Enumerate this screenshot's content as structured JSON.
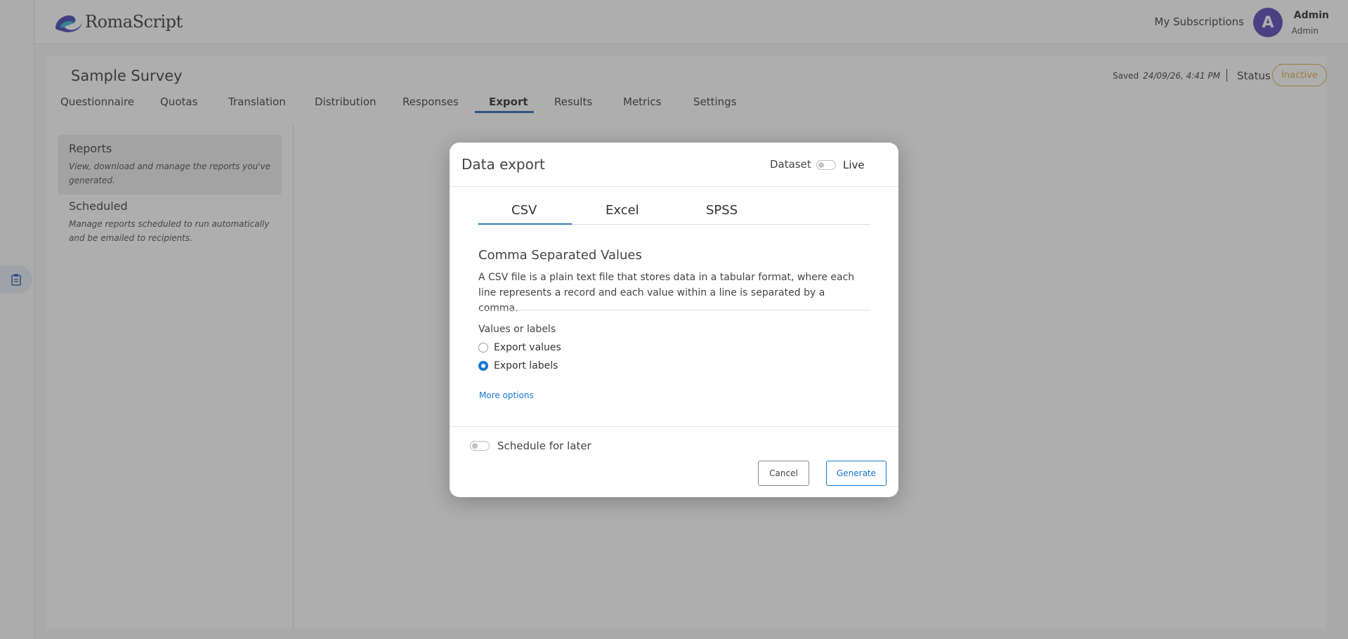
{
  "app": {
    "brand": "RomaScript",
    "subscriptions_label": "My Subscriptions",
    "avatar_initial": "A",
    "user_name": "Admin",
    "user_role": "Admin"
  },
  "survey": {
    "title": "Sample Survey",
    "saved_label": "Saved",
    "saved_time": "24/09/26, 4:41 PM",
    "status_label": "Status",
    "status_value": "Inactive",
    "tabs": [
      "Questionnaire",
      "Quotas",
      "Translation",
      "Distribution",
      "Responses",
      "Export",
      "Results",
      "Metrics",
      "Settings"
    ],
    "active_tab": "Export"
  },
  "sidebar": {
    "items": [
      {
        "title": "Reports",
        "desc": "View, download and manage the reports you've generated."
      },
      {
        "title": "Scheduled",
        "desc": "Manage reports scheduled to run automatically and be emailed to recipients."
      }
    ]
  },
  "modal": {
    "title": "Data export",
    "dataset_label": "Dataset",
    "live_label": "Live",
    "format_tabs": [
      "CSV",
      "Excel",
      "SPSS"
    ],
    "active_format": "CSV",
    "format_title": "Comma Separated Values",
    "format_desc": "A CSV file is a plain text file that stores data in a tabular format, where each line represents a record and each value within a line is separated by a comma.",
    "values_or_labels": "Values or labels",
    "options": [
      {
        "label": "Export values",
        "checked": false
      },
      {
        "label": "Export labels",
        "checked": true
      }
    ],
    "more_options": "More options",
    "schedule_label": "Schedule for later",
    "cancel": "Cancel",
    "generate": "Generate"
  },
  "colors": {
    "accent": "#1677d2",
    "status_inactive": "#e6a23c",
    "avatar": "#4f3bb2"
  }
}
